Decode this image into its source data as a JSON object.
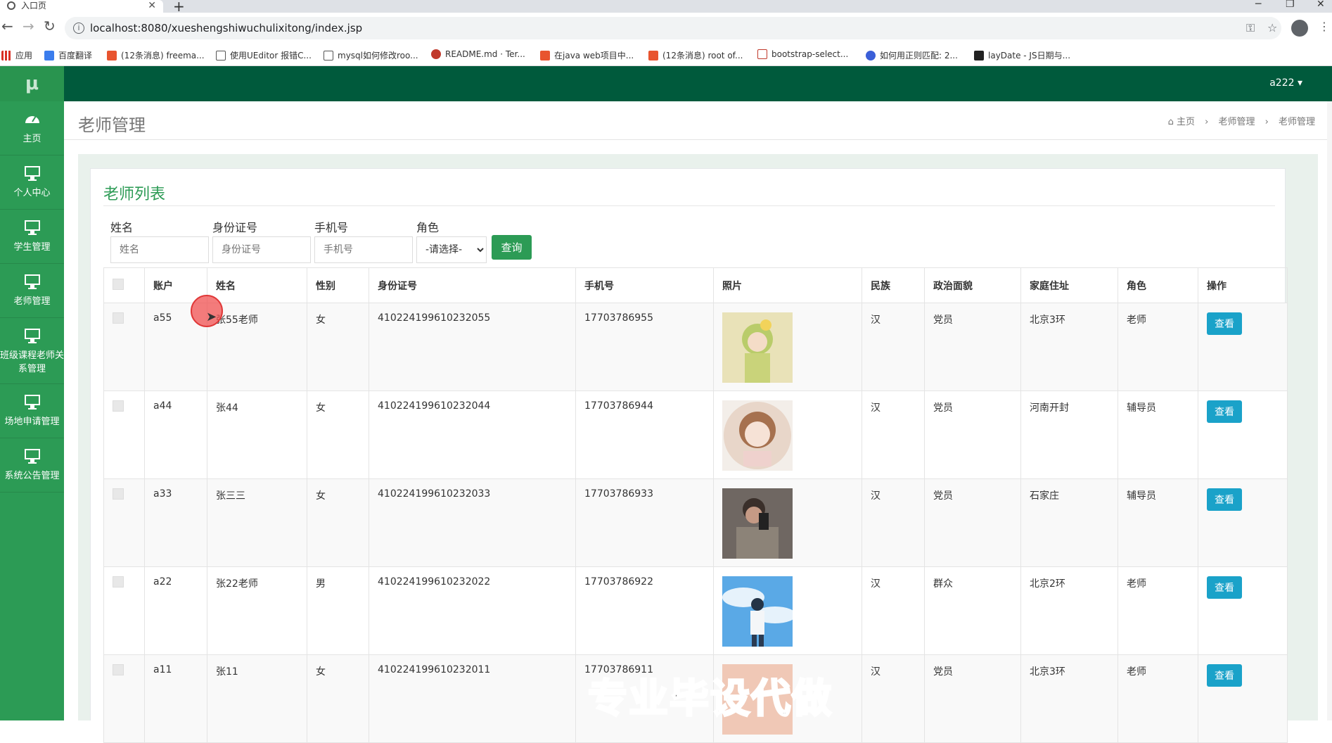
{
  "browser": {
    "tab_title": "入口页",
    "url": "localhost:8080/xueshengshiwuchulixitong/index.jsp",
    "bookmarks": [
      "应用",
      "百度翻译",
      "(12条消息) freema...",
      "使用UEditor 报错C...",
      "mysql如何修改roo...",
      "README.md · Ter...",
      "在java web项目中...",
      "(12条消息) root of...",
      "bootstrap-select...",
      "如何用正则匹配: 2...",
      "layDate - JS日期与..."
    ]
  },
  "sidebar": {
    "logo": "μ",
    "items": [
      "主页",
      "个人中心",
      "学生管理",
      "老师管理",
      "班级课程老师关系管理",
      "场地申请管理",
      "系统公告管理"
    ]
  },
  "topbar": {
    "user": "a222 ▾"
  },
  "header": {
    "title": "老师管理",
    "breadcrumb": [
      "主页",
      "老师管理",
      "老师管理"
    ]
  },
  "panel": {
    "title": "老师列表",
    "search": {
      "name_label": "姓名",
      "name_placeholder": "姓名",
      "id_label": "身份证号",
      "id_placeholder": "身份证号",
      "phone_label": "手机号",
      "phone_placeholder": "手机号",
      "role_label": "角色",
      "role_selected": "-请选择-",
      "query_button": "查询"
    },
    "columns": [
      "账户",
      "姓名",
      "性别",
      "身份证号",
      "手机号",
      "照片",
      "民族",
      "政治面貌",
      "家庭住址",
      "角色",
      "操作"
    ],
    "rows": [
      {
        "account": "a55",
        "name": "张55老师",
        "gender": "女",
        "idcard": "410224199610232055",
        "phone": "17703786955",
        "ethnic": "汉",
        "political": "党员",
        "address": "北京3环",
        "role": "老师",
        "action": "查看"
      },
      {
        "account": "a44",
        "name": "张44",
        "gender": "女",
        "idcard": "410224199610232044",
        "phone": "17703786944",
        "ethnic": "汉",
        "political": "党员",
        "address": "河南开封",
        "role": "辅导员",
        "action": "查看"
      },
      {
        "account": "a33",
        "name": "张三三",
        "gender": "女",
        "idcard": "410224199610232033",
        "phone": "17703786933",
        "ethnic": "汉",
        "political": "党员",
        "address": "石家庄",
        "role": "辅导员",
        "action": "查看"
      },
      {
        "account": "a22",
        "name": "张22老师",
        "gender": "男",
        "idcard": "410224199610232022",
        "phone": "17703786922",
        "ethnic": "汉",
        "political": "群众",
        "address": "北京2环",
        "role": "老师",
        "action": "查看"
      },
      {
        "account": "a11",
        "name": "张11",
        "gender": "女",
        "idcard": "410224199610232011",
        "phone": "17703786911",
        "ethnic": "汉",
        "political": "党员",
        "address": "北京3环",
        "role": "老师",
        "action": "查看"
      }
    ]
  },
  "overlay": {
    "watermark": "专业毕设代做"
  },
  "colors": {
    "sidebar": "#2c9b55",
    "topbar": "#005a3c",
    "view_button": "#1aa2c9",
    "accent": "#2c9b55"
  }
}
